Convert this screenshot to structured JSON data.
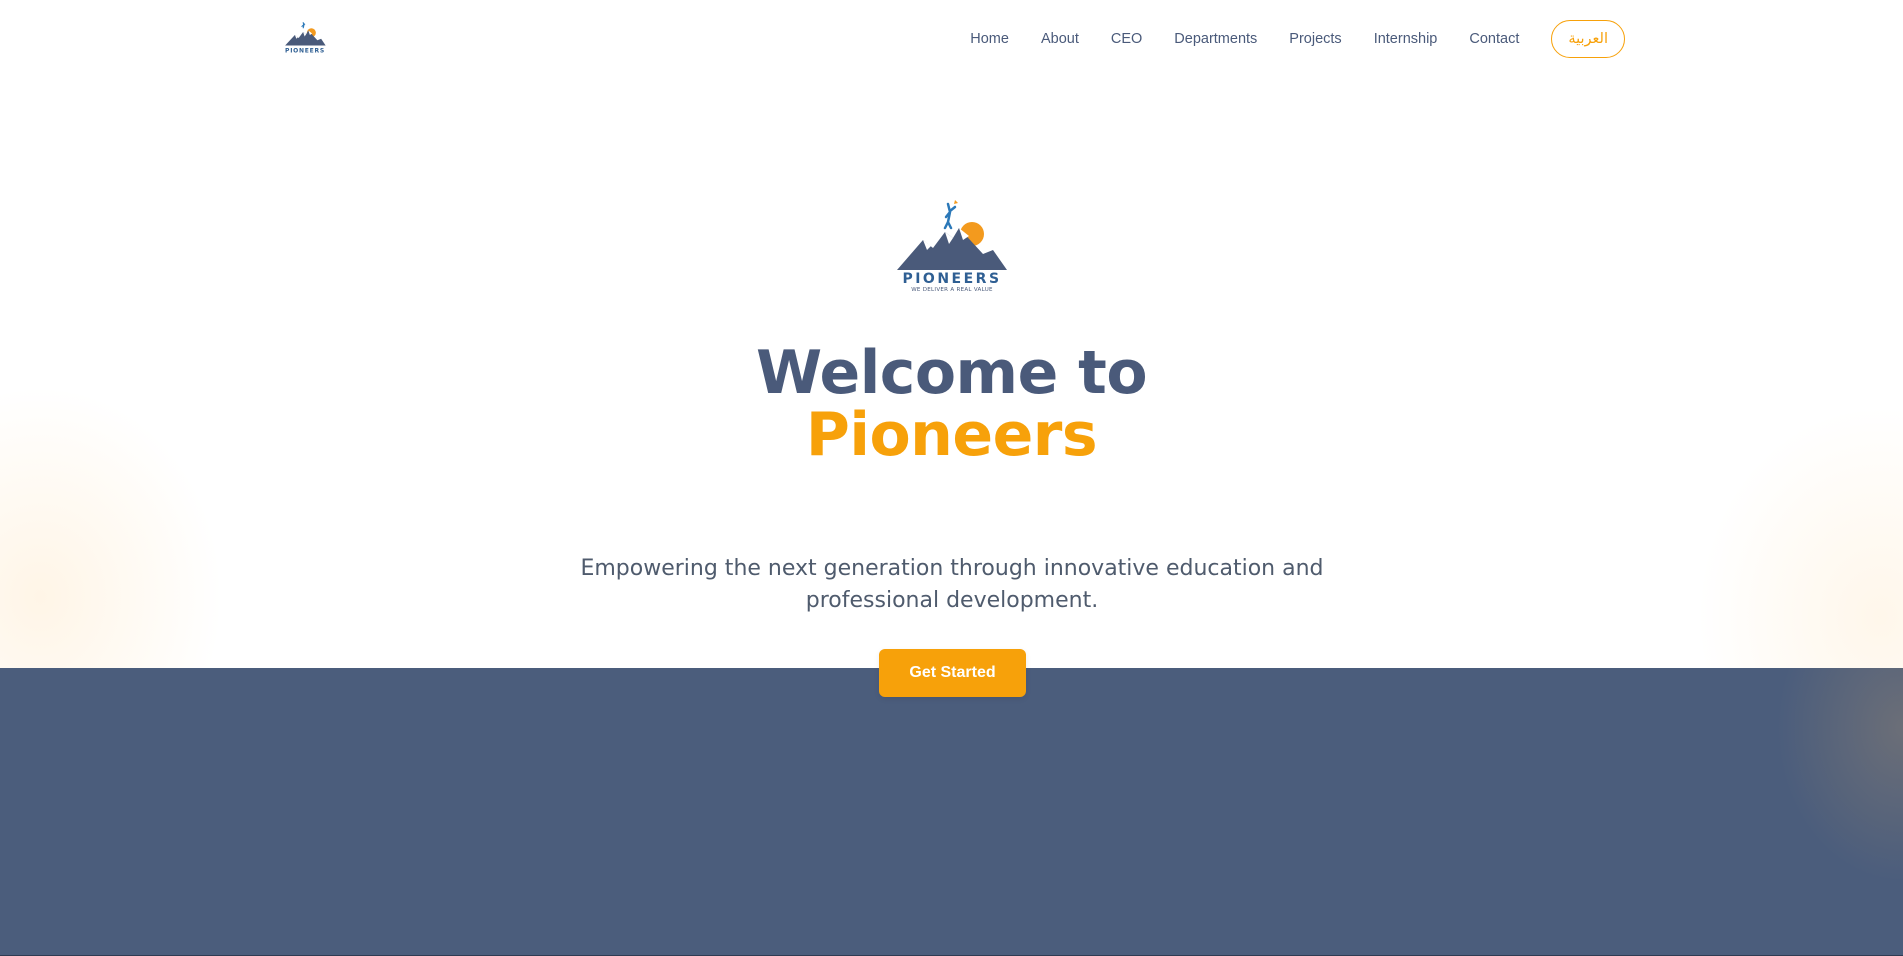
{
  "header": {
    "logo_text": "PIONEERS",
    "nav": [
      "Home",
      "About",
      "CEO",
      "Departments",
      "Projects",
      "Internship",
      "Contact"
    ],
    "language_button": "العربية"
  },
  "hero": {
    "logo": {
      "wordmark": "PIONEERS",
      "tagline": "WE DELIVER A REAL VALUE"
    },
    "title_line1": "Welcome to",
    "title_line2": "Pioneers",
    "subtitle": "Empowering the next generation through innovative education and professional development.",
    "cta_label": "Get Started"
  },
  "colors": {
    "navy": "#4a5a7a",
    "accent": "#f7a10a",
    "band": "#4b5d7c"
  },
  "icons": {
    "logo": "mountain-climber-logo"
  }
}
